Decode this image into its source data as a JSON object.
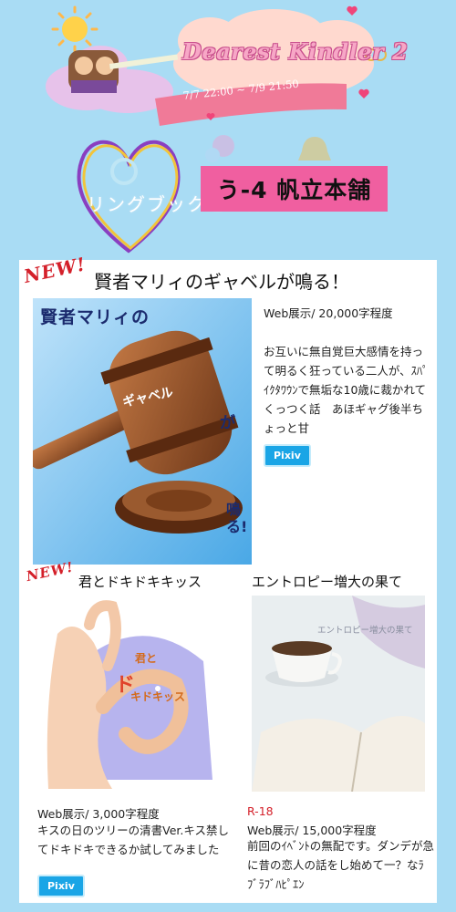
{
  "event": {
    "title": "Dearest Kindler 2",
    "dates": "7/7 22:00 ~ 7/9 21:50",
    "ring_text": "リングブックセール"
  },
  "booth": {
    "label": "う-4 帆立本舗"
  },
  "main_work": {
    "new_badge": "NEW!",
    "title": "賢者マリィのギャベルが鳴る！",
    "cover_text_top": "賢者マリィの",
    "cover_text_gavel": "ギャベル",
    "cover_text_ga": "が",
    "cover_text_bottom": "鳴る!",
    "info": "Web展示/ 20,000字程度",
    "description": "お互いに無自覚巨大感情を持って明るく狂っている二人が、ｽﾊﾟｲｸﾀﾜｳﾝで無垢な10歳に裁かれてくっつく話　あほギャグ後半ちょっと甘",
    "link_label": "Pixiv"
  },
  "work_left": {
    "new_badge": "NEW!",
    "title": "君とドキドキキッス",
    "cover_text_1": "君と",
    "cover_text_2": "ド",
    "cover_text_3": "キドキッス",
    "info": "Web展示/ 3,000字程度",
    "description": "キスの日のツリーの清書Ver.キス禁してドキドキできるか試してみました",
    "link_label": "Pixiv"
  },
  "work_right": {
    "title": "エントロピー増大の果て",
    "cover_text": "エントロピー増大の果て",
    "rating": "R-18",
    "info": "Web展示/ 15,000字程度",
    "description": "前回のｲﾍﾞﾝﾄの無配です。ダンデが急に昔の恋人の話をし始めて一？なﾗﾌﾞﾗﾌﾞﾊﾋﾟｴﾝ"
  },
  "colors": {
    "page_bg": "#a9dcf4",
    "booth_bg": "#f05fa0",
    "new_red": "#d4202a",
    "pixiv_blue": "#1aa5e6",
    "rating_red": "#d4202a"
  }
}
